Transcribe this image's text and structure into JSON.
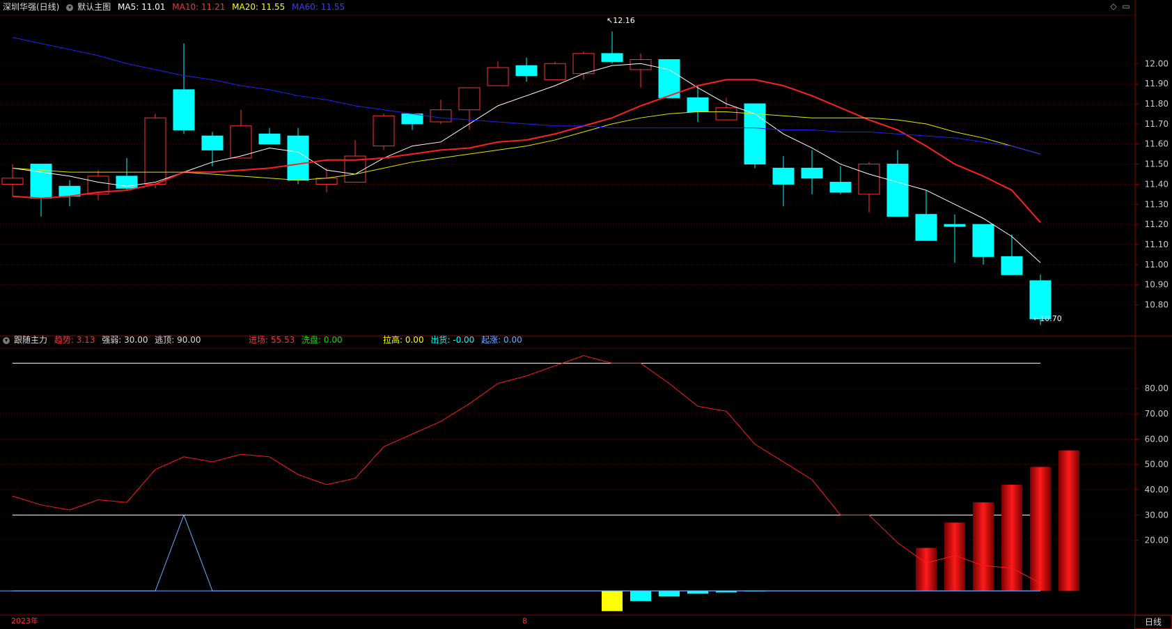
{
  "main_header": {
    "title": "深圳华强(日线)",
    "mode": "默认主图",
    "ma5": "MA5: 11.01",
    "ma10": "MA10: 11.21",
    "ma20": "MA20: 11.55",
    "ma60": "MA60: 11.55"
  },
  "sub_header": {
    "title": "跟随主力",
    "trend": "趋势: 3.13",
    "strength": "强弱: 30.00",
    "top": "逃顶: 90.00",
    "enter": "进场: 55.53",
    "wash": "洗盘: 0.00",
    "pull": "拉高: 0.00",
    "ship": "出货: -0.00",
    "rise": "起涨: 0.00"
  },
  "annotations": {
    "high": "12.16",
    "low": "10.70"
  },
  "bottom": {
    "year_label": "2023年",
    "month_label": "8",
    "period_button": "日线"
  },
  "colors": {
    "up": "#ff3232",
    "down": "#00ffff",
    "ma5": "#ffffff",
    "ma10": "#ff2020",
    "ma20": "#e6e600",
    "ma60": "#2020ff",
    "axis": "#8b0000",
    "grid": "#5a0000"
  },
  "chart_data": [
    {
      "type": "candlestick",
      "title": "深圳华强(日线)",
      "y_ticks": [
        "12.00",
        "11.90",
        "11.80",
        "11.70",
        "11.60",
        "11.50",
        "11.40",
        "11.30",
        "11.20",
        "11.10",
        "11.00",
        "10.90",
        "10.80"
      ],
      "y_values": [
        12.0,
        11.9,
        11.8,
        11.7,
        11.6,
        11.5,
        11.4,
        11.3,
        11.2,
        11.1,
        11.0,
        10.9,
        10.8
      ],
      "ylim": [
        10.66,
        12.24
      ],
      "candles": [
        {
          "o": 11.4,
          "h": 11.5,
          "l": 11.34,
          "c": 11.43
        },
        {
          "o": 11.5,
          "h": 11.5,
          "l": 11.24,
          "c": 11.33
        },
        {
          "o": 11.39,
          "h": 11.42,
          "l": 11.29,
          "c": 11.34
        },
        {
          "o": 11.35,
          "h": 11.47,
          "l": 11.32,
          "c": 11.44
        },
        {
          "o": 11.44,
          "h": 11.53,
          "l": 11.37,
          "c": 11.38
        },
        {
          "o": 11.4,
          "h": 11.75,
          "l": 11.38,
          "c": 11.73
        },
        {
          "o": 11.87,
          "h": 12.1,
          "l": 11.65,
          "c": 11.67
        },
        {
          "o": 11.64,
          "h": 11.66,
          "l": 11.49,
          "c": 11.57
        },
        {
          "o": 11.53,
          "h": 11.77,
          "l": 11.53,
          "c": 11.69
        },
        {
          "o": 11.65,
          "h": 11.68,
          "l": 11.6,
          "c": 11.6
        },
        {
          "o": 11.64,
          "h": 11.68,
          "l": 11.4,
          "c": 11.42
        },
        {
          "o": 11.4,
          "h": 11.48,
          "l": 11.36,
          "c": 11.43
        },
        {
          "o": 11.41,
          "h": 11.62,
          "l": 11.41,
          "c": 11.54
        },
        {
          "o": 11.59,
          "h": 11.75,
          "l": 11.57,
          "c": 11.74
        },
        {
          "o": 11.75,
          "h": 11.75,
          "l": 11.67,
          "c": 11.7
        },
        {
          "o": 11.71,
          "h": 11.82,
          "l": 11.7,
          "c": 11.77
        },
        {
          "o": 11.77,
          "h": 11.88,
          "l": 11.67,
          "c": 11.88
        },
        {
          "o": 11.89,
          "h": 12.01,
          "l": 11.89,
          "c": 11.98
        },
        {
          "o": 11.99,
          "h": 12.03,
          "l": 11.91,
          "c": 11.94
        },
        {
          "o": 11.92,
          "h": 12.01,
          "l": 11.92,
          "c": 12.0
        },
        {
          "o": 11.95,
          "h": 12.06,
          "l": 11.92,
          "c": 12.05
        },
        {
          "o": 12.05,
          "h": 12.16,
          "l": 12.0,
          "c": 12.01
        },
        {
          "o": 11.97,
          "h": 12.05,
          "l": 11.88,
          "c": 12.02
        },
        {
          "o": 12.02,
          "h": 12.02,
          "l": 11.84,
          "c": 11.83
        },
        {
          "o": 11.83,
          "h": 11.89,
          "l": 11.71,
          "c": 11.76
        },
        {
          "o": 11.72,
          "h": 11.83,
          "l": 11.72,
          "c": 11.78
        },
        {
          "o": 11.8,
          "h": 11.8,
          "l": 11.48,
          "c": 11.5
        },
        {
          "o": 11.48,
          "h": 11.54,
          "l": 11.29,
          "c": 11.4
        },
        {
          "o": 11.48,
          "h": 11.57,
          "l": 11.35,
          "c": 11.43
        },
        {
          "o": 11.41,
          "h": 11.49,
          "l": 11.35,
          "c": 11.36
        },
        {
          "o": 11.35,
          "h": 11.51,
          "l": 11.26,
          "c": 11.5
        },
        {
          "o": 11.5,
          "h": 11.57,
          "l": 11.24,
          "c": 11.24
        },
        {
          "o": 11.25,
          "h": 11.37,
          "l": 11.12,
          "c": 11.12
        },
        {
          "o": 11.2,
          "h": 11.25,
          "l": 11.01,
          "c": 11.19
        },
        {
          "o": 11.2,
          "h": 11.2,
          "l": 11.0,
          "c": 11.04
        },
        {
          "o": 11.04,
          "h": 11.15,
          "l": 10.95,
          "c": 10.95
        },
        {
          "o": 10.92,
          "h": 10.95,
          "l": 10.7,
          "c": 10.73
        }
      ],
      "series": [
        {
          "name": "MA5",
          "values": [
            11.48,
            11.46,
            11.44,
            11.41,
            11.39,
            11.41,
            11.46,
            11.51,
            11.54,
            11.58,
            11.56,
            11.47,
            11.45,
            11.53,
            11.59,
            11.61,
            11.7,
            11.79,
            11.84,
            11.89,
            11.95,
            11.99,
            12.0,
            11.97,
            11.88,
            11.8,
            11.75,
            11.65,
            11.58,
            11.5,
            11.45,
            11.41,
            11.37,
            11.3,
            11.23,
            11.14,
            11.01
          ]
        },
        {
          "name": "MA10",
          "values": [
            11.34,
            11.33,
            11.34,
            11.36,
            11.37,
            11.4,
            11.46,
            11.46,
            11.47,
            11.48,
            11.5,
            11.52,
            11.52,
            11.53,
            11.55,
            11.57,
            11.58,
            11.61,
            11.62,
            11.65,
            11.69,
            11.73,
            11.79,
            11.84,
            11.89,
            11.92,
            11.92,
            11.89,
            11.84,
            11.78,
            11.72,
            11.67,
            11.59,
            11.5,
            11.44,
            11.37,
            11.21
          ]
        },
        {
          "name": "MA20",
          "values": [
            11.48,
            11.47,
            11.46,
            11.46,
            11.46,
            11.46,
            11.46,
            11.45,
            11.44,
            11.43,
            11.42,
            11.43,
            11.45,
            11.48,
            11.51,
            11.53,
            11.55,
            11.57,
            11.59,
            11.62,
            11.66,
            11.7,
            11.73,
            11.75,
            11.76,
            11.76,
            11.75,
            11.74,
            11.73,
            11.73,
            11.73,
            11.72,
            11.7,
            11.66,
            11.63,
            11.59,
            11.55
          ]
        },
        {
          "name": "MA60",
          "values": [
            12.13,
            12.1,
            12.07,
            12.04,
            12.0,
            11.97,
            11.94,
            11.92,
            11.89,
            11.87,
            11.84,
            11.82,
            11.79,
            11.77,
            11.75,
            11.73,
            11.72,
            11.71,
            11.7,
            11.69,
            11.69,
            11.68,
            11.68,
            11.68,
            11.68,
            11.68,
            11.68,
            11.67,
            11.67,
            11.66,
            11.66,
            11.65,
            11.64,
            11.63,
            11.61,
            11.59,
            11.55
          ]
        }
      ]
    },
    {
      "type": "bar",
      "title": "跟随主力",
      "y_ticks": [
        "80.00",
        "70.00",
        "60.00",
        "50.00",
        "40.00",
        "30.00",
        "20.00"
      ],
      "y_values": [
        80,
        70,
        60,
        50,
        40,
        30,
        20
      ],
      "ylim": [
        -9,
        97
      ],
      "lines": {
        "top": 90,
        "strength": 30,
        "base": 0
      },
      "series": [
        {
          "name": "趋势",
          "values": [
            37.5,
            34,
            32,
            36,
            35,
            48,
            53,
            51,
            54,
            53,
            46,
            42,
            44.5,
            57,
            62,
            67,
            74,
            82,
            85,
            89,
            93,
            90,
            90,
            82,
            73,
            71,
            58,
            51,
            44,
            30,
            30,
            19,
            11,
            14,
            10,
            9,
            3.13
          ]
        },
        {
          "name": "进场",
          "values": [
            0,
            0,
            0,
            0,
            0,
            0,
            0,
            0,
            0,
            0,
            0,
            0,
            0,
            0,
            0,
            0,
            0,
            0,
            0,
            0,
            0,
            0,
            0,
            0,
            0,
            0,
            0,
            0,
            0,
            0,
            0,
            0,
            17,
            27,
            35,
            42,
            49,
            55.53
          ]
        },
        {
          "name": "洗盘",
          "values": [
            0,
            0,
            0,
            0,
            0,
            0,
            0,
            0,
            0,
            0,
            0,
            0,
            0,
            0,
            0,
            0,
            0,
            0,
            0,
            0,
            0,
            -8,
            -4,
            -2.2,
            -1.1,
            -0.6,
            -0.2,
            0,
            0,
            0,
            0,
            0,
            0,
            0,
            0,
            0,
            0
          ]
        },
        {
          "name": "起涨",
          "values": [
            0,
            0,
            0,
            0,
            0,
            0,
            30,
            0,
            0,
            0,
            0,
            0,
            0,
            0,
            0,
            0,
            0,
            0,
            0,
            0,
            0,
            0,
            0,
            0,
            0,
            0,
            0,
            0,
            0,
            0,
            0,
            0,
            0,
            0,
            0,
            0,
            0
          ]
        }
      ]
    }
  ]
}
